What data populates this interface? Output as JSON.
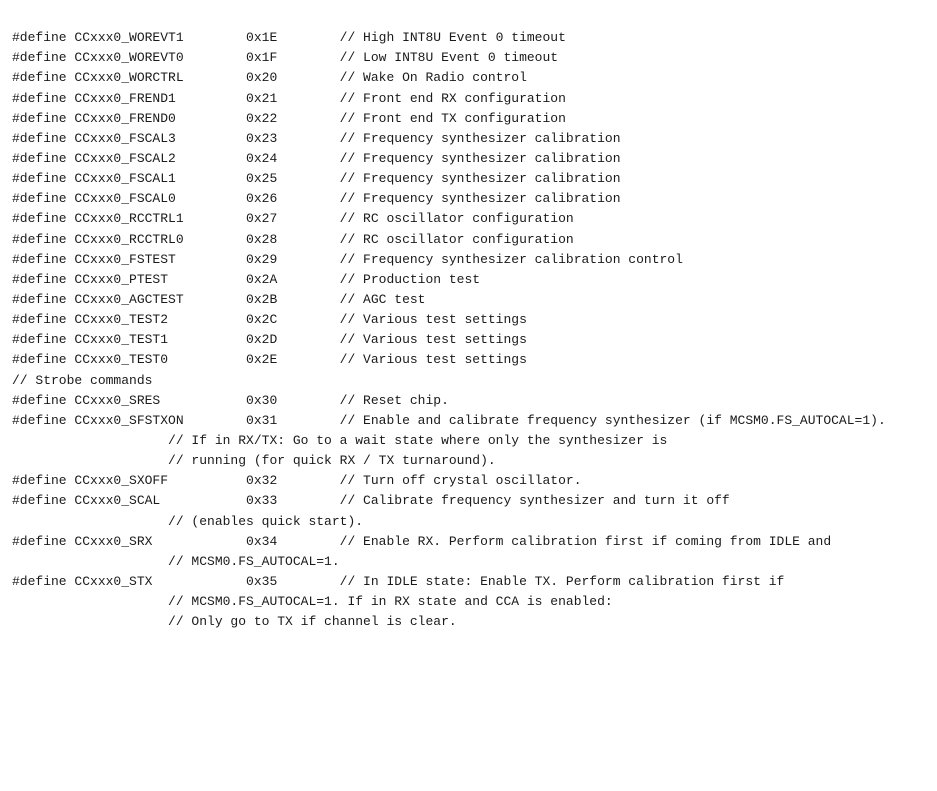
{
  "lines": [
    {
      "type": "define",
      "name": "#define CCxxx0_WOREVT1",
      "hex": "0x1E",
      "comment": "// High INT8U Event 0 timeout"
    },
    {
      "type": "define",
      "name": "#define CCxxx0_WOREVT0",
      "hex": "0x1F",
      "comment": "// Low INT8U Event 0 timeout"
    },
    {
      "type": "define",
      "name": "#define CCxxx0_WORCTRL",
      "hex": "0x20",
      "comment": "// Wake On Radio control"
    },
    {
      "type": "define",
      "name": "#define CCxxx0_FREND1",
      "hex": "0x21",
      "comment": "// Front end RX configuration"
    },
    {
      "type": "define",
      "name": "#define CCxxx0_FREND0",
      "hex": "0x22",
      "comment": "// Front end TX configuration"
    },
    {
      "type": "define",
      "name": "#define CCxxx0_FSCAL3",
      "hex": "0x23",
      "comment": "// Frequency synthesizer calibration"
    },
    {
      "type": "define",
      "name": "#define CCxxx0_FSCAL2",
      "hex": "0x24",
      "comment": "// Frequency synthesizer calibration"
    },
    {
      "type": "define",
      "name": "#define CCxxx0_FSCAL1",
      "hex": "0x25",
      "comment": "// Frequency synthesizer calibration"
    },
    {
      "type": "define",
      "name": "#define CCxxx0_FSCAL0",
      "hex": "0x26",
      "comment": "// Frequency synthesizer calibration"
    },
    {
      "type": "define",
      "name": "#define CCxxx0_RCCTRL1",
      "hex": "0x27",
      "comment": "// RC oscillator configuration"
    },
    {
      "type": "define",
      "name": "#define CCxxx0_RCCTRL0",
      "hex": "0x28",
      "comment": "// RC oscillator configuration"
    },
    {
      "type": "define",
      "name": "#define CCxxx0_FSTEST",
      "hex": "0x29",
      "comment": "// Frequency synthesizer calibration control"
    },
    {
      "type": "define",
      "name": "#define CCxxx0_PTEST",
      "hex": "0x2A",
      "comment": "// Production test"
    },
    {
      "type": "define",
      "name": "#define CCxxx0_AGCTEST",
      "hex": "0x2B",
      "comment": "// AGC test"
    },
    {
      "type": "define",
      "name": "#define CCxxx0_TEST2",
      "hex": "0x2C",
      "comment": "// Various test settings"
    },
    {
      "type": "define",
      "name": "#define CCxxx0_TEST1",
      "hex": "0x2D",
      "comment": "// Various test settings"
    },
    {
      "type": "define",
      "name": "#define CCxxx0_TEST0",
      "hex": "0x2E",
      "comment": "// Various test settings"
    },
    {
      "type": "comment_only",
      "text": "// Strobe commands"
    },
    {
      "type": "define",
      "name": "#define CCxxx0_SRES",
      "hex": "0x30",
      "comment": "// Reset chip."
    },
    {
      "type": "define_long",
      "name": "#define CCxxx0_SFSTXON",
      "hex": "0x31",
      "comment": "// Enable and calibrate frequency synthesizer (if MCSM0.FS_AUTOCAL=1)."
    },
    {
      "type": "continuation",
      "text": "// If in RX/TX: Go to a wait state where only the synthesizer is"
    },
    {
      "type": "continuation",
      "text": "// running (for quick RX / TX turnaround)."
    },
    {
      "type": "define",
      "name": "#define CCxxx0_SXOFF",
      "hex": "0x32",
      "comment": "// Turn off crystal oscillator."
    },
    {
      "type": "define_long",
      "name": "#define CCxxx0_SCAL",
      "hex": "0x33",
      "comment": "// Calibrate frequency synthesizer and turn it off"
    },
    {
      "type": "continuation",
      "text": "// (enables quick start)."
    },
    {
      "type": "define_long",
      "name": "#define CCxxx0_SRX",
      "hex": "0x34",
      "comment": "// Enable RX. Perform calibration first if coming from IDLE and"
    },
    {
      "type": "continuation",
      "text": "// MCSM0.FS_AUTOCAL=1."
    },
    {
      "type": "define_long",
      "name": "#define CCxxx0_STX",
      "hex": "0x35",
      "comment": "// In IDLE state: Enable TX. Perform calibration first if"
    },
    {
      "type": "continuation",
      "text": "// MCSM0.FS_AUTOCAL=1. If in RX state and CCA is enabled:"
    },
    {
      "type": "continuation",
      "text": "// Only go to TX if channel is clear."
    }
  ]
}
